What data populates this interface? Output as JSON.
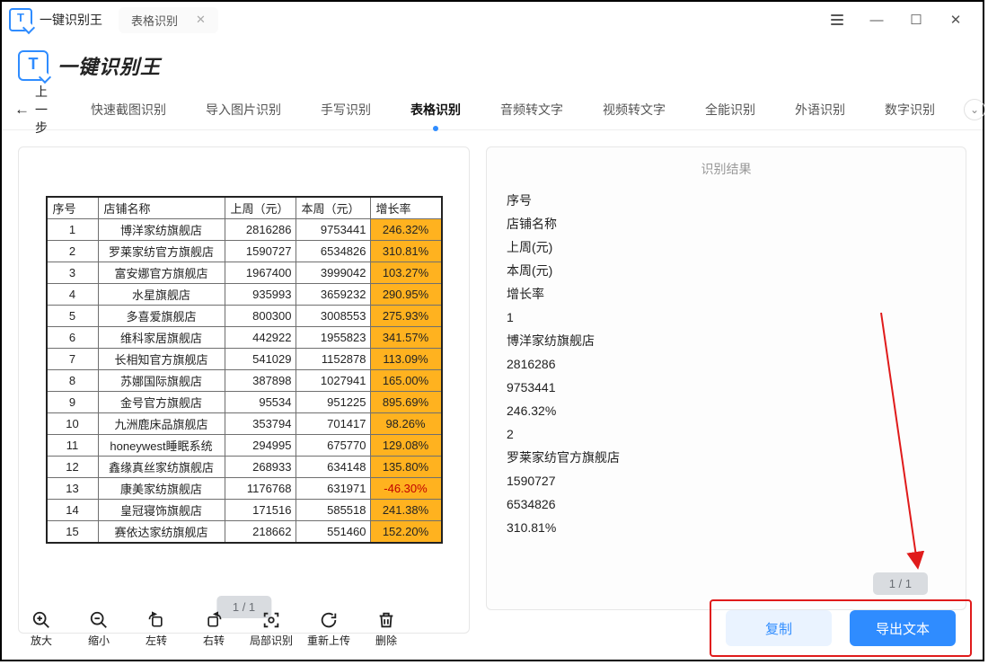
{
  "window": {
    "app_title": "一键识别王",
    "tab_label": "表格识别"
  },
  "header": {
    "brand_glyph": "T",
    "brand_name": "一键识别王"
  },
  "toolbar": {
    "back": "上一步",
    "items": [
      "快速截图识别",
      "导入图片识别",
      "手写识别",
      "表格识别",
      "音频转文字",
      "视频转文字",
      "全能识别",
      "外语识别",
      "数字识别"
    ],
    "active_index": 3
  },
  "left_pager": "1 / 1",
  "table": {
    "headers": [
      "序号",
      "店铺名称",
      "上周（元）",
      "本周（元）",
      "增长率"
    ],
    "rows": [
      {
        "n": "1",
        "name": "博洋家纺旗舰店",
        "a": "2816286",
        "b": "9753441",
        "r": "246.32%"
      },
      {
        "n": "2",
        "name": "罗莱家纺官方旗舰店",
        "a": "1590727",
        "b": "6534826",
        "r": "310.81%"
      },
      {
        "n": "3",
        "name": "富安娜官方旗舰店",
        "a": "1967400",
        "b": "3999042",
        "r": "103.27%"
      },
      {
        "n": "4",
        "name": "水星旗舰店",
        "a": "935993",
        "b": "3659232",
        "r": "290.95%"
      },
      {
        "n": "5",
        "name": "多喜爱旗舰店",
        "a": "800300",
        "b": "3008553",
        "r": "275.93%"
      },
      {
        "n": "6",
        "name": "维科家居旗舰店",
        "a": "442922",
        "b": "1955823",
        "r": "341.57%"
      },
      {
        "n": "7",
        "name": "长相知官方旗舰店",
        "a": "541029",
        "b": "1152878",
        "r": "113.09%"
      },
      {
        "n": "8",
        "name": "苏娜国际旗舰店",
        "a": "387898",
        "b": "1027941",
        "r": "165.00%"
      },
      {
        "n": "9",
        "name": "金号官方旗舰店",
        "a": "95534",
        "b": "951225",
        "r": "895.69%"
      },
      {
        "n": "10",
        "name": "九洲鹿床品旗舰店",
        "a": "353794",
        "b": "701417",
        "r": "98.26%"
      },
      {
        "n": "11",
        "name": "honeywest睡眠系统",
        "a": "294995",
        "b": "675770",
        "r": "129.08%"
      },
      {
        "n": "12",
        "name": "鑫缘真丝家纺旗舰店",
        "a": "268933",
        "b": "634148",
        "r": "135.80%"
      },
      {
        "n": "13",
        "name": "康美家纺旗舰店",
        "a": "1176768",
        "b": "631971",
        "r": "-46.30%",
        "neg": true
      },
      {
        "n": "14",
        "name": "皇冠寝饰旗舰店",
        "a": "171516",
        "b": "585518",
        "r": "241.38%"
      },
      {
        "n": "15",
        "name": "赛依达家纺旗舰店",
        "a": "218662",
        "b": "551460",
        "r": "152.20%"
      }
    ]
  },
  "right": {
    "title": "识别结果",
    "lines": [
      "序号",
      "店铺名称",
      "上周(元)",
      "本周(元)",
      "增长率",
      "1",
      "博洋家纺旗舰店",
      "2816286",
      "9753441",
      "246.32%",
      "2",
      "罗莱家纺官方旗舰店",
      "1590727",
      "6534826",
      "310.81%"
    ],
    "pager": "1 / 1"
  },
  "bottom": {
    "actions": [
      {
        "id": "zoom-in",
        "label": "放大"
      },
      {
        "id": "zoom-out",
        "label": "缩小"
      },
      {
        "id": "rotate-left",
        "label": "左转"
      },
      {
        "id": "rotate-right",
        "label": "右转"
      },
      {
        "id": "crop-ocr",
        "label": "局部识别"
      },
      {
        "id": "reupload",
        "label": "重新上传"
      },
      {
        "id": "delete",
        "label": "删除"
      }
    ],
    "copy": "复制",
    "export": "导出文本"
  }
}
